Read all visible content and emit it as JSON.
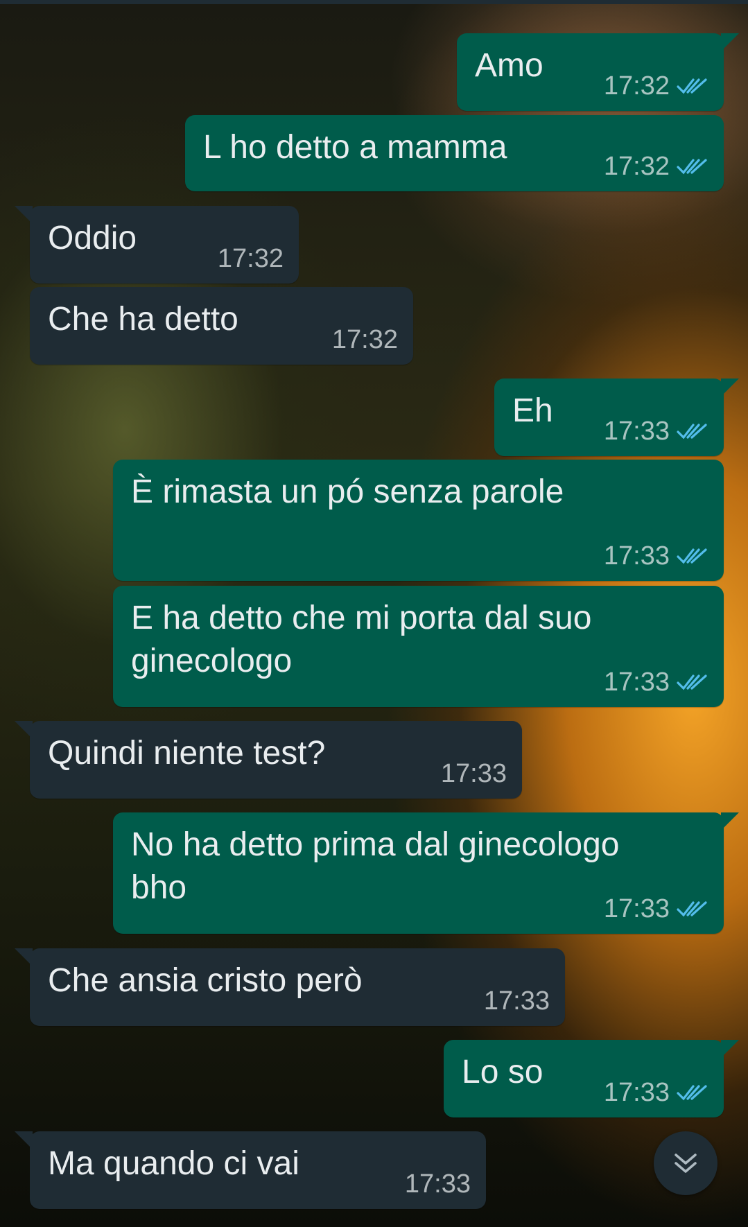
{
  "colors": {
    "outgoing_bubble": "#005c4b",
    "incoming_bubble": "#1f2c34",
    "read_tick": "#53bdeb",
    "text": "#e9edef"
  },
  "messages": [
    {
      "direction": "out",
      "text": "Amo",
      "time": "17:32",
      "status": "read"
    },
    {
      "direction": "out",
      "text": "L ho detto a mamma",
      "time": "17:32",
      "status": "read"
    },
    {
      "direction": "in",
      "text": "Oddio",
      "time": "17:32"
    },
    {
      "direction": "in",
      "text": "Che ha detto",
      "time": "17:32"
    },
    {
      "direction": "out",
      "text": "Eh",
      "time": "17:33",
      "status": "read"
    },
    {
      "direction": "out",
      "text": "È rimasta un pó senza parole",
      "time": "17:33",
      "status": "read"
    },
    {
      "direction": "out",
      "text_lines": [
        "E ha detto che mi porta dal suo",
        "ginecologo"
      ],
      "time": "17:33",
      "status": "read"
    },
    {
      "direction": "in",
      "text": "Quindi niente test?",
      "time": "17:33"
    },
    {
      "direction": "out",
      "text_lines": [
        "No ha detto prima dal ginecologo",
        "bho"
      ],
      "time": "17:33",
      "status": "read"
    },
    {
      "direction": "in",
      "text": "Che ansia cristo però",
      "time": "17:33"
    },
    {
      "direction": "out",
      "text": "Lo so",
      "time": "17:33",
      "status": "read"
    },
    {
      "direction": "in",
      "text": "Ma quando ci vai",
      "time": "17:33"
    }
  ],
  "scroll_button": {
    "icon": "double-chevron-down-icon"
  }
}
